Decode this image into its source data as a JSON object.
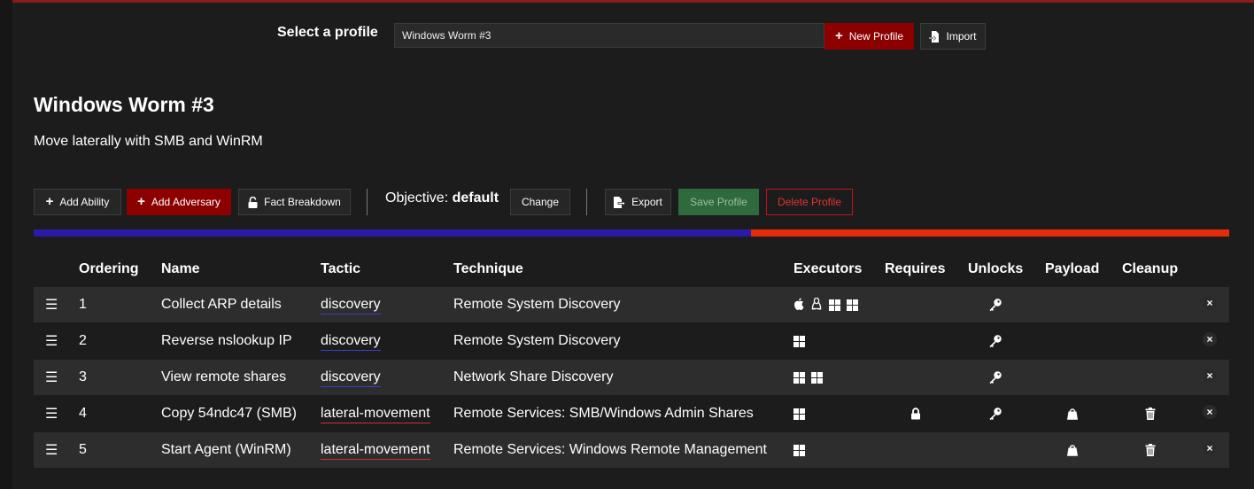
{
  "profile_selector": {
    "label": "Select a profile",
    "selected": "Windows Worm #3",
    "new_profile_label": "New Profile",
    "import_label": "Import"
  },
  "profile": {
    "title": "Windows Worm #3",
    "description": "Move laterally with SMB and WinRM"
  },
  "toolbar": {
    "add_ability": "Add Ability",
    "add_adversary": "Add Adversary",
    "fact_breakdown": "Fact Breakdown",
    "objective_label": "Objective:",
    "objective_value": "default",
    "change": "Change",
    "export": "Export",
    "save_profile": "Save Profile",
    "delete_profile": "Delete Profile"
  },
  "table": {
    "headers": {
      "ordering": "Ordering",
      "name": "Name",
      "tactic": "Tactic",
      "technique": "Technique",
      "executors": "Executors",
      "requires": "Requires",
      "unlocks": "Unlocks",
      "payload": "Payload",
      "cleanup": "Cleanup"
    },
    "rows": [
      {
        "order": "1",
        "name": "Collect ARP details",
        "tactic": "discovery",
        "technique": "Remote System Discovery",
        "executors": [
          "apple-icon",
          "linux-icon",
          "windows-icon",
          "windows-icon"
        ],
        "requires": false,
        "unlocks": true,
        "payload": false,
        "cleanup": false
      },
      {
        "order": "2",
        "name": "Reverse nslookup IP",
        "tactic": "discovery",
        "technique": "Remote System Discovery",
        "executors": [
          "windows-icon"
        ],
        "requires": false,
        "unlocks": true,
        "payload": false,
        "cleanup": false
      },
      {
        "order": "3",
        "name": "View remote shares",
        "tactic": "discovery",
        "technique": "Network Share Discovery",
        "executors": [
          "windows-icon",
          "windows-icon"
        ],
        "requires": false,
        "unlocks": true,
        "payload": false,
        "cleanup": false
      },
      {
        "order": "4",
        "name": "Copy 54ndc47 (SMB)",
        "tactic": "lateral-movement",
        "technique": "Remote Services: SMB/Windows Admin Shares",
        "executors": [
          "windows-icon"
        ],
        "requires": true,
        "unlocks": true,
        "payload": true,
        "cleanup": true
      },
      {
        "order": "5",
        "name": "Start Agent (WinRM)",
        "tactic": "lateral-movement",
        "technique": "Remote Services: Windows Remote Management",
        "executors": [
          "windows-icon"
        ],
        "requires": false,
        "unlocks": false,
        "payload": true,
        "cleanup": true
      }
    ]
  },
  "colors": {
    "tactic_discovery": "#3d3dcc",
    "tactic_lateral_movement": "#cc3333",
    "progress_discovery": "#2a1aa6",
    "progress_lateral": "#e52c0a",
    "accent_red": "#8c0000"
  },
  "icons": {
    "menu": "☰",
    "close": "×",
    "plus": "+"
  }
}
